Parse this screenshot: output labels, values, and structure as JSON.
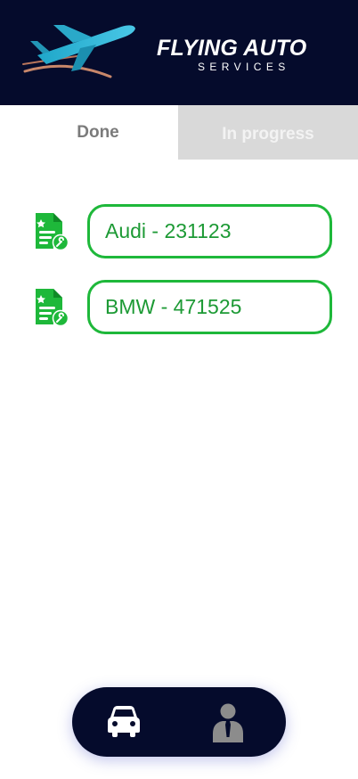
{
  "header": {
    "brand_title": "FLYING AUTO",
    "brand_subtitle": "SERVICES",
    "logo_icon": "airplane-logo",
    "background": "#050b2c"
  },
  "tabs": [
    {
      "label": "Done",
      "active": true
    },
    {
      "label": "In progress",
      "active": false
    }
  ],
  "orders": [
    {
      "label": "Audi - 231123",
      "icon": "service-document-icon"
    },
    {
      "label": "BMW - 471525",
      "icon": "service-document-icon"
    }
  ],
  "bottom_nav": {
    "items": [
      {
        "icon": "car-icon",
        "active": true
      },
      {
        "icon": "user-icon",
        "active": false
      }
    ]
  },
  "colors": {
    "accent_green": "#1eb83a",
    "navy": "#050b2c",
    "inactive_tab": "#d9d9d9"
  }
}
